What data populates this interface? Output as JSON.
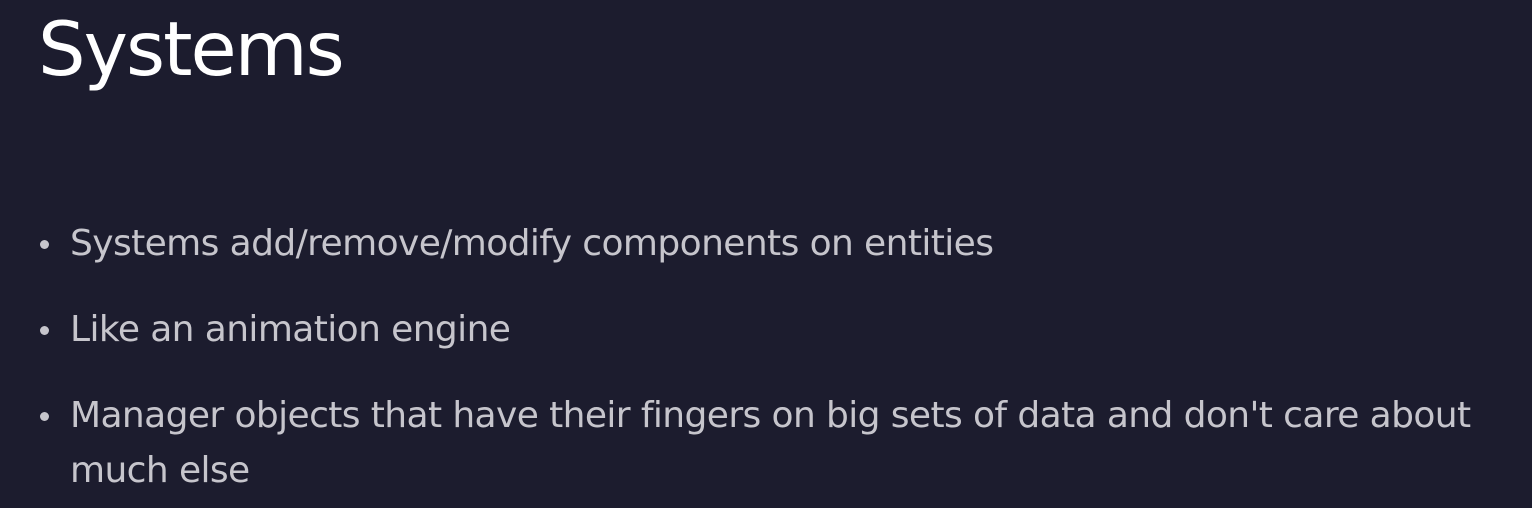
{
  "slide": {
    "title": "Systems",
    "bullets": [
      {
        "text": "Systems add/remove/modify components on entities"
      },
      {
        "text": "Like an animation engine"
      },
      {
        "text": "Manager objects that have their fingers on big sets of data and don't care about much else"
      }
    ]
  },
  "colors": {
    "background": "#1c1c2e",
    "title": "#ffffff",
    "body_text": "#c6c5cc"
  }
}
